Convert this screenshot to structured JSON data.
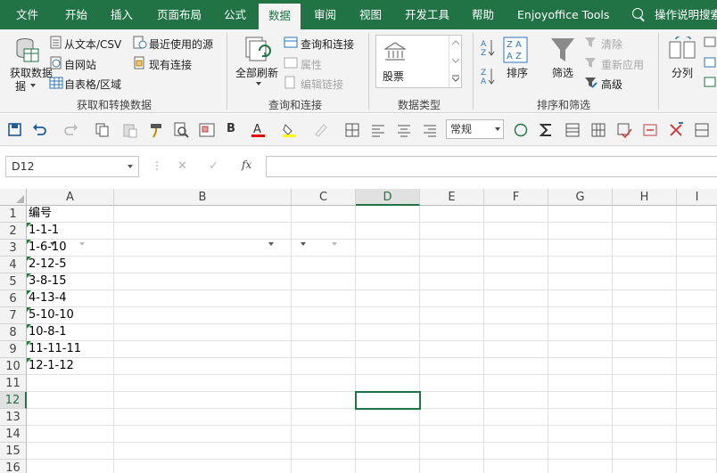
{
  "tabs": [
    "文件",
    "开始",
    "插入",
    "页面布局",
    "公式",
    "数据",
    "审阅",
    "视图",
    "开发工具",
    "帮助",
    "Enjoyoffice Tools",
    "操作说明搜索"
  ],
  "active_tab": "数据",
  "ribbon": {
    "get_data": "获取数据",
    "get_data_sub": "据",
    "from_text": "从文本/CSV",
    "from_web": "自网站",
    "from_table": "自表格/区域",
    "recent_sources": "最近使用的源",
    "existing_conn": "现有连接",
    "group_get": "获取和转换数据",
    "refresh_all": "全部刷新",
    "queries_conn": "查询和连接",
    "properties": "属性",
    "edit_links": "编辑链接",
    "group_queries": "查询和连接",
    "stocks": "股票",
    "group_datatypes": "数据类型",
    "sort": "排序",
    "filter": "筛选",
    "clear": "清除",
    "reapply": "重新应用",
    "advanced": "高级",
    "group_sortfilter": "排序和筛选",
    "split": "分列"
  },
  "qat": {
    "bold": "B",
    "number_format": "常规"
  },
  "formula_bar": {
    "name_box": "D12",
    "cancel": "✕",
    "enter": "✓",
    "fx": "fx",
    "formula": ""
  },
  "columns": [
    "A",
    "B",
    "C",
    "D",
    "E",
    "F",
    "G",
    "H",
    "I"
  ],
  "rows": [
    "1",
    "2",
    "3",
    "4",
    "5",
    "6",
    "7",
    "8",
    "9",
    "10",
    "11",
    "12",
    "13",
    "14",
    "15",
    "16"
  ],
  "cells_A": [
    "编号",
    "1-1-1",
    "1-6-10",
    "2-12-5",
    "3-8-15",
    "4-13-4",
    "5-10-10",
    "10-8-1",
    "11-11-11",
    "12-1-12",
    "",
    "",
    "",
    "",
    "",
    ""
  ],
  "colors": {
    "accent": "#217346",
    "flag": "#1e7d3a"
  }
}
